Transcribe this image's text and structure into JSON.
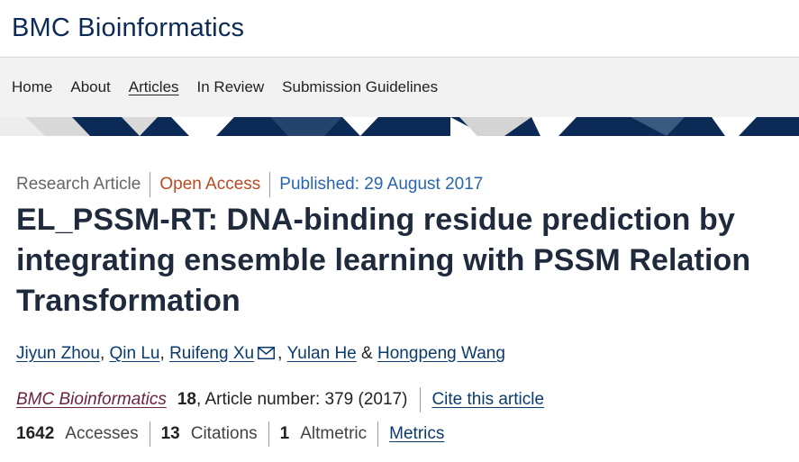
{
  "header": {
    "journal_title": "BMC Bioinformatics"
  },
  "nav": {
    "items": [
      {
        "label": "Home"
      },
      {
        "label": "About"
      },
      {
        "label": "Articles"
      },
      {
        "label": "In Review"
      },
      {
        "label": "Submission Guidelines"
      }
    ],
    "active": "Articles"
  },
  "article": {
    "type": "Research Article",
    "access": "Open Access",
    "published": "Published: 29 August 2017",
    "title": "EL_PSSM-RT: DNA-binding residue prediction by integrating ensemble learning with PSSM Relation Transformation",
    "authors": [
      {
        "name": "Jiyun Zhou"
      },
      {
        "name": "Qin Lu"
      },
      {
        "name": "Ruifeng Xu"
      },
      {
        "name": "Yulan He"
      },
      {
        "name": "Hongpeng Wang"
      }
    ],
    "author_separator": ",",
    "author_last_joiner": "&",
    "citation": {
      "journal": "BMC Bioinformatics",
      "volume": "18",
      "details": ", Article number: 379 (2017)",
      "cite_link": "Cite this article"
    },
    "metrics": {
      "accesses": {
        "value": "1642",
        "label": "Accesses"
      },
      "citations": {
        "value": "13",
        "label": "Citations"
      },
      "altmetric": {
        "value": "1",
        "label": "Altmetric"
      },
      "metrics_link": "Metrics"
    }
  },
  "colors": {
    "brand": "#0b2b56",
    "open_access": "#b84a1f",
    "published": "#2a66b0",
    "journal_link": "#6b2341"
  },
  "icons": {
    "corresponding_author": "mail-icon"
  }
}
